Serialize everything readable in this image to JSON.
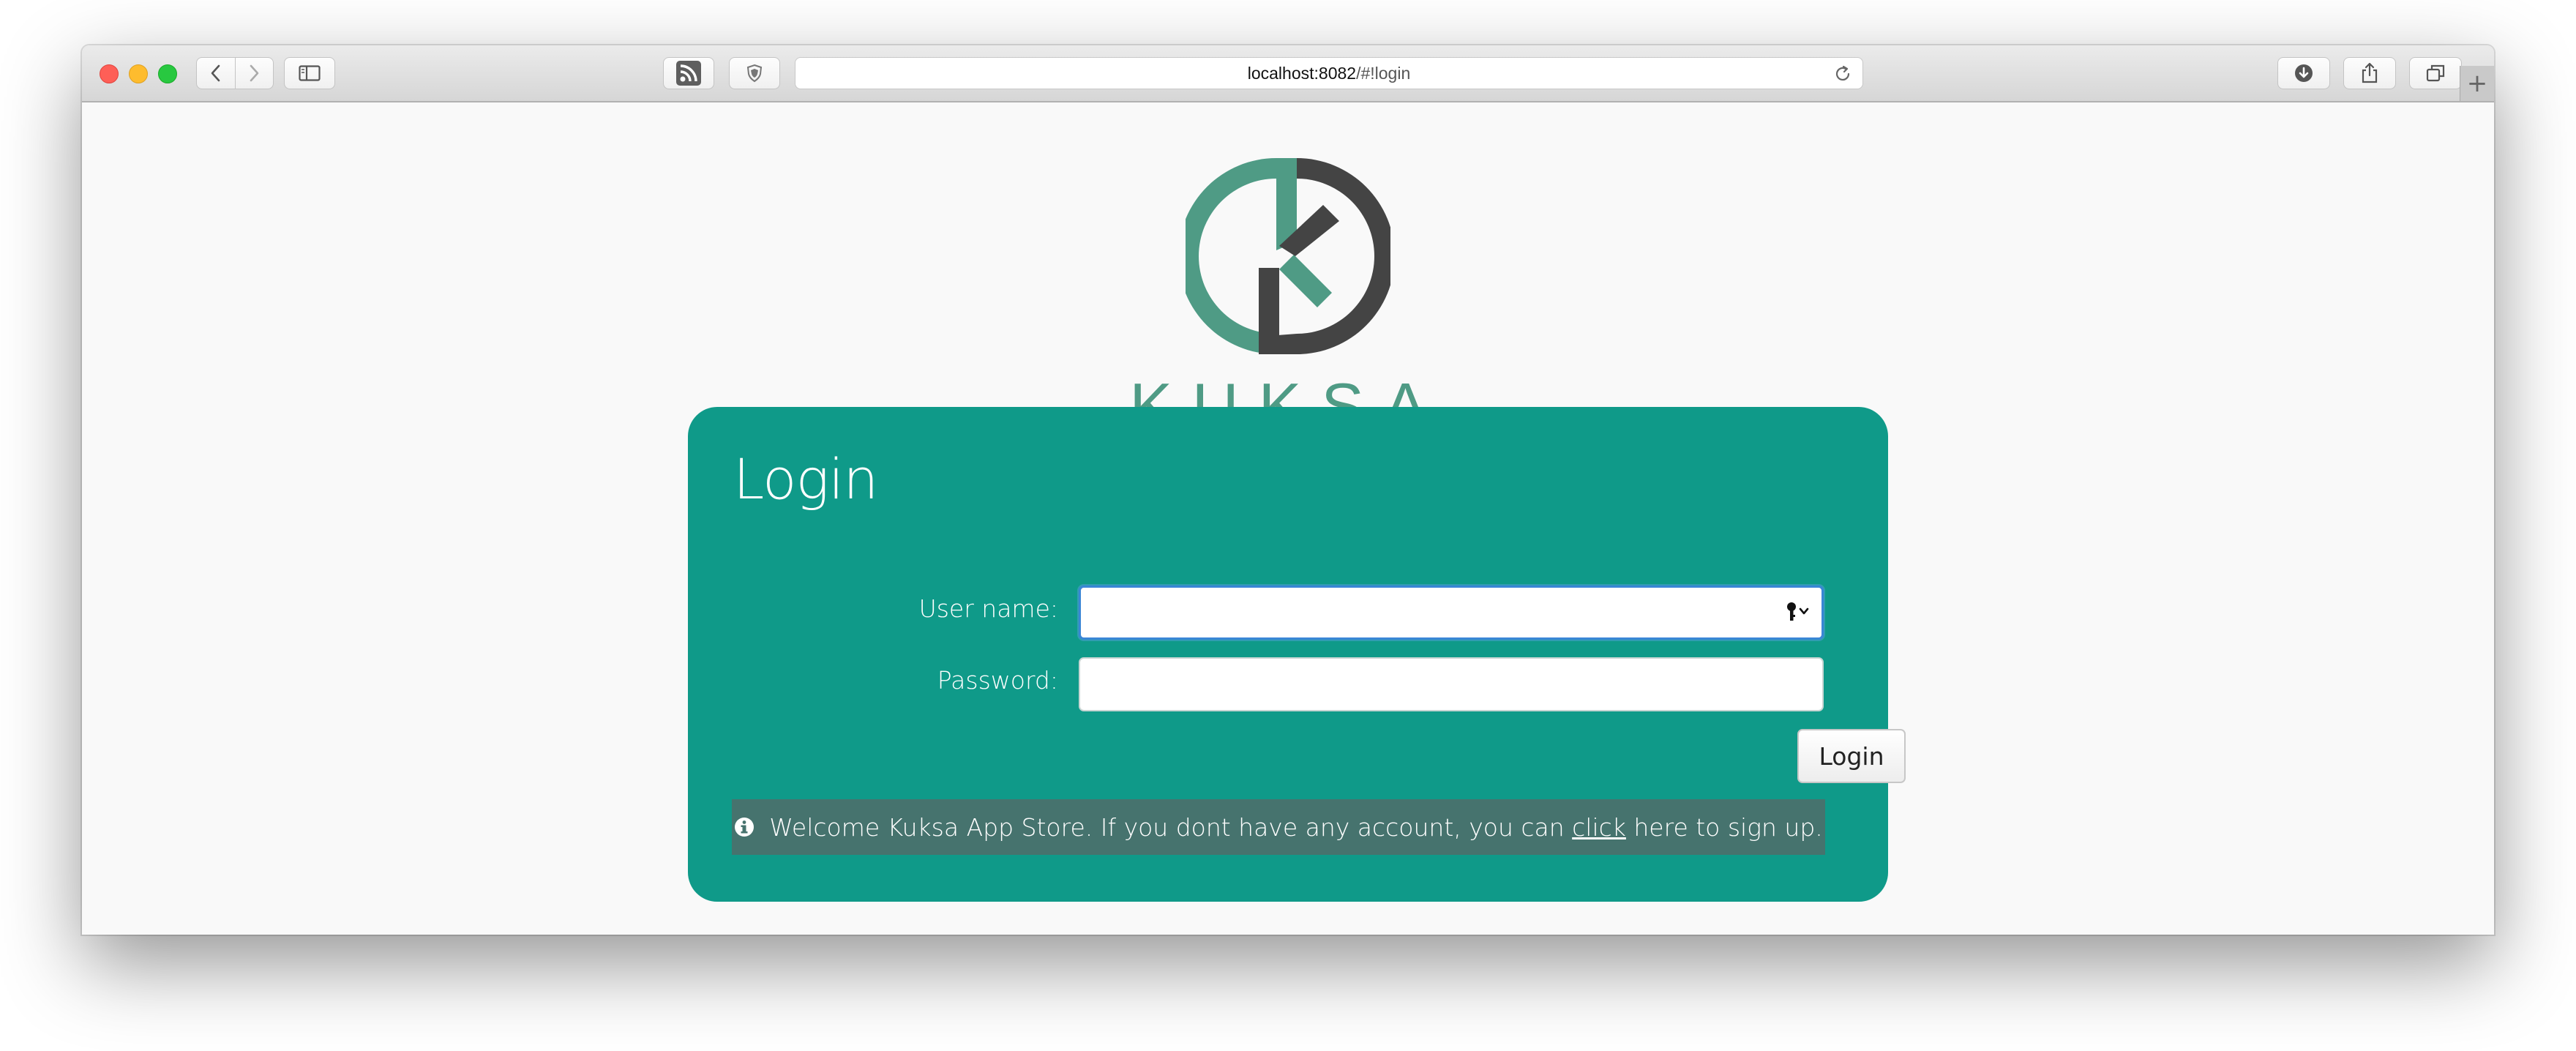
{
  "browser": {
    "url_host": "localhost:8082",
    "url_path": "/#!login",
    "new_tab_label": "+"
  },
  "brand": {
    "name": "KUKSA",
    "colors": {
      "logo_green": "#4f9b85",
      "logo_dark": "#444444",
      "card_teal": "#0f9a89",
      "info_bar": "#46736e",
      "focus_blue": "#3a86d6"
    }
  },
  "login_form": {
    "title": "Login",
    "username_label": "User name:",
    "username_value": "",
    "password_label": "Password:",
    "password_value": "",
    "submit_label": "Login"
  },
  "info_message": {
    "icon": "info-circle-icon",
    "text_before": "Welcome Kuksa App Store. If you dont have any account, you can",
    "link_text": "click",
    "text_after": "here to sign up."
  },
  "icons": {
    "toolbar": [
      "back-icon",
      "forward-icon",
      "sidebar-icon",
      "rss-icon",
      "shield-icon",
      "reload-icon",
      "download-icon",
      "share-icon",
      "tabs-icon"
    ],
    "input": "key-autofill-icon"
  }
}
